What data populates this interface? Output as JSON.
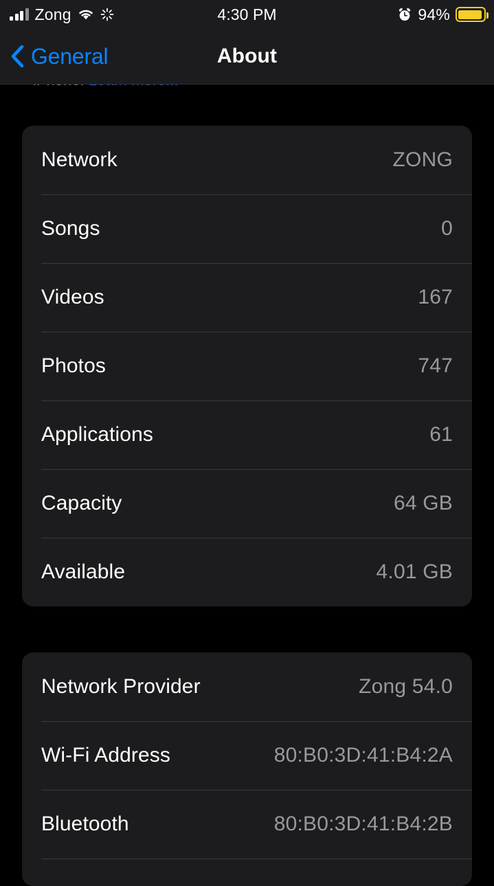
{
  "status_bar": {
    "carrier": "Zong",
    "time": "4:30 PM",
    "battery_percent": "94%",
    "signal_icon": "cellular-signal-icon",
    "wifi_icon": "wifi-icon",
    "activity_icon": "activity-spinner-icon",
    "alarm_icon": "alarm-clock-icon",
    "battery_icon": "battery-icon",
    "battery_color": "#f5ce26"
  },
  "nav": {
    "back_label": "General",
    "back_icon": "chevron-left-icon",
    "title": "About",
    "accent_color": "#0a84ff"
  },
  "clipped_footer": {
    "text": "iPhone. ",
    "link_text": "Learn more..."
  },
  "groups": [
    {
      "id": "storage",
      "rows": [
        {
          "label": "Network",
          "value": "ZONG"
        },
        {
          "label": "Songs",
          "value": "0"
        },
        {
          "label": "Videos",
          "value": "167"
        },
        {
          "label": "Photos",
          "value": "747"
        },
        {
          "label": "Applications",
          "value": "61"
        },
        {
          "label": "Capacity",
          "value": "64 GB"
        },
        {
          "label": "Available",
          "value": "4.01 GB"
        }
      ]
    },
    {
      "id": "network",
      "rows": [
        {
          "label": "Network Provider",
          "value": "Zong 54.0"
        },
        {
          "label": "Wi-Fi Address",
          "value": "80:B0:3D:41:B4:2A"
        },
        {
          "label": "Bluetooth",
          "value": "80:B0:3D:41:B4:2B"
        },
        {
          "label": "",
          "value": ""
        }
      ]
    }
  ]
}
